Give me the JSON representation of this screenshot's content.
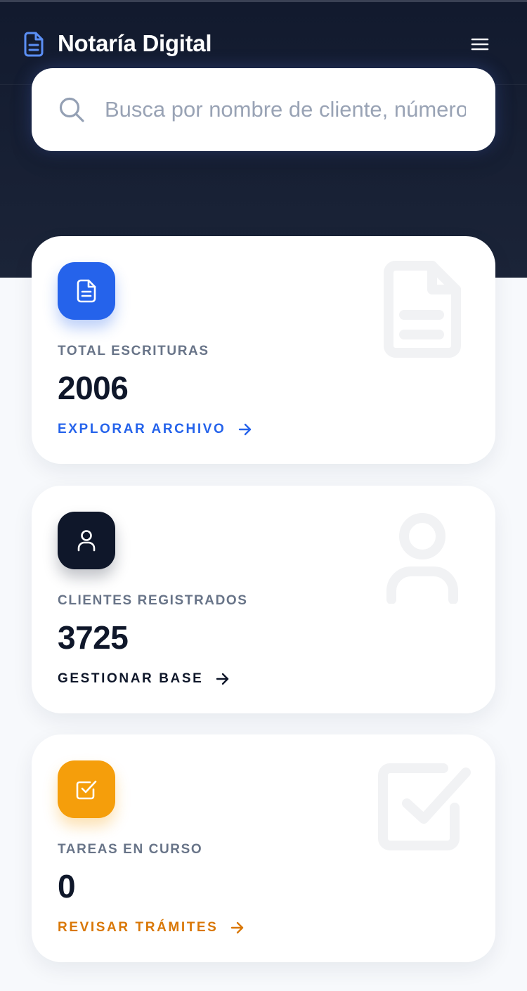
{
  "app": {
    "title": "Notaría Digital",
    "logo_icon": "document-icon",
    "menu_icon": "hamburger-menu-icon"
  },
  "search": {
    "placeholder": "Busca por nombre de cliente, número de escritura...",
    "value": "",
    "icon": "search-icon"
  },
  "colors": {
    "header_bg": "#121a2e",
    "blue": "#2563eb",
    "dark": "#0f172a",
    "amber": "#f59e0b",
    "amber_text": "#d97706",
    "muted": "#687488"
  },
  "stats": [
    {
      "icon": "document-icon",
      "label": "TOTAL ESCRITURAS",
      "value": "2006",
      "link": "EXPLORAR ARCHIVO",
      "link_icon": "arrow-right-icon"
    },
    {
      "icon": "user-icon",
      "label": "CLIENTES REGISTRADOS",
      "value": "3725",
      "link": "GESTIONAR BASE",
      "link_icon": "arrow-right-icon"
    },
    {
      "icon": "checkbox-icon",
      "label": "TAREAS EN CURSO",
      "value": "0",
      "link": "REVISAR TRÁMITES",
      "link_icon": "arrow-right-icon"
    }
  ]
}
